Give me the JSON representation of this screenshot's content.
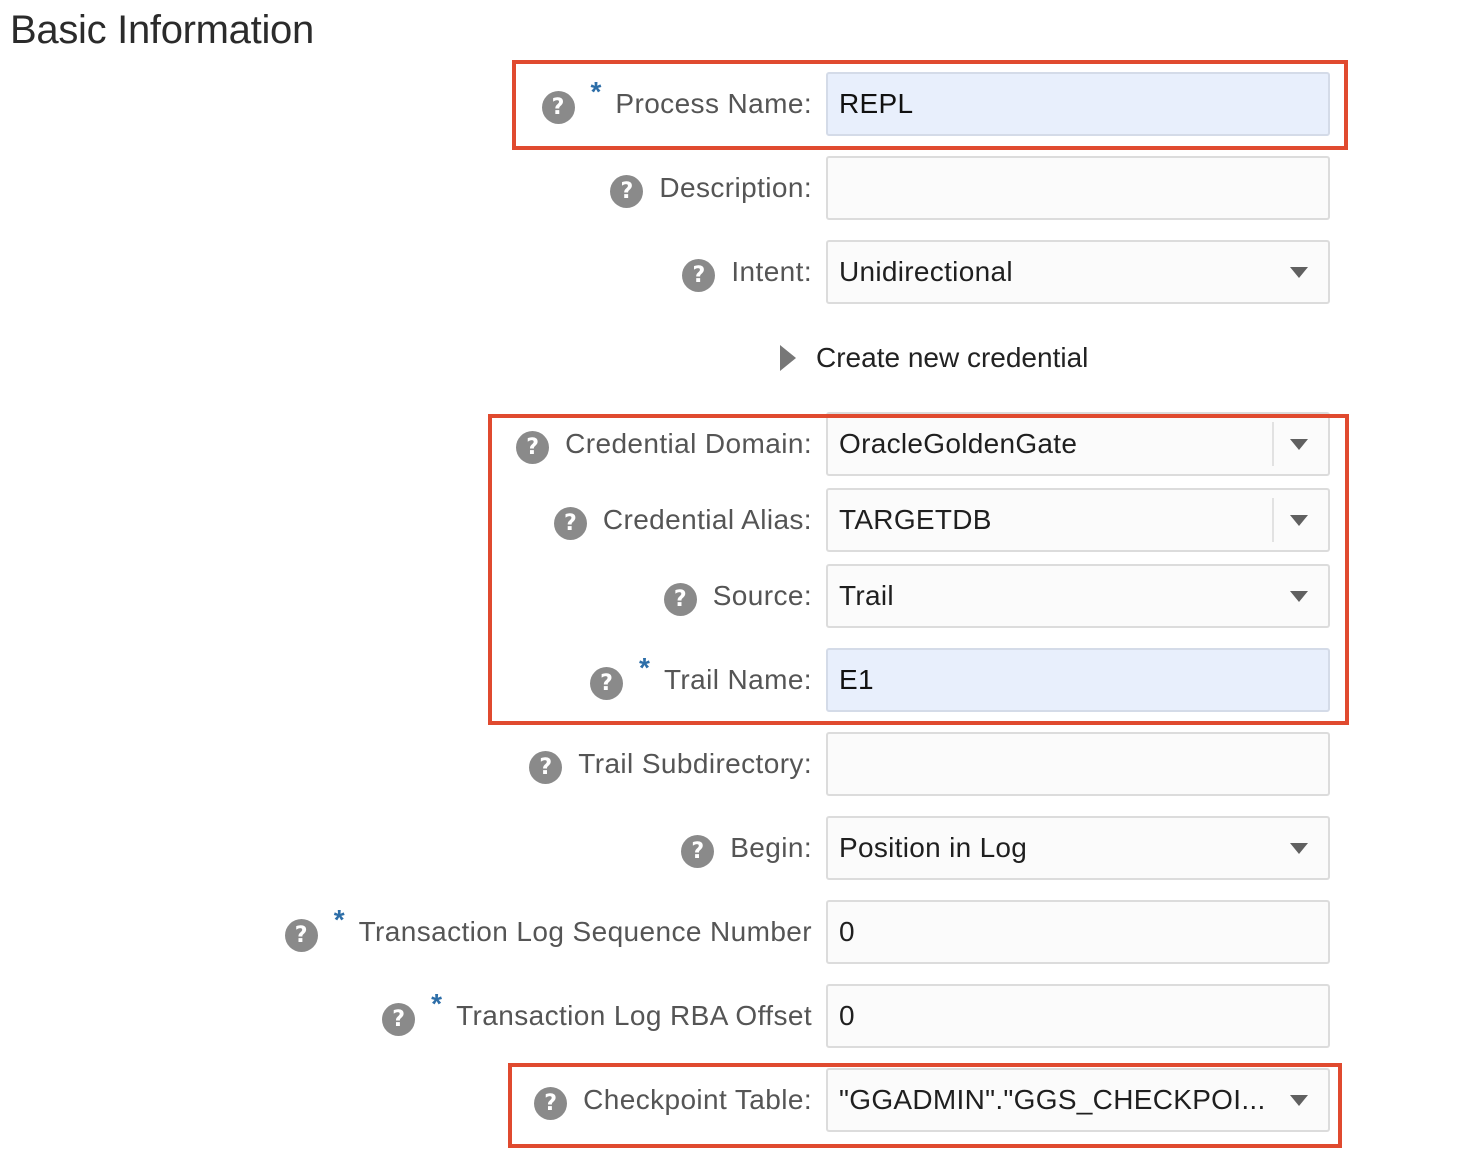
{
  "section_title": "Basic Information",
  "process_name": {
    "label": "Process Name:",
    "value": "REPL",
    "required": true
  },
  "description": {
    "label": "Description:",
    "value": ""
  },
  "intent": {
    "label": "Intent:",
    "value": "Unidirectional"
  },
  "create_credential": {
    "label": "Create new credential"
  },
  "credential_domain": {
    "label": "Credential Domain:",
    "value": "OracleGoldenGate"
  },
  "credential_alias": {
    "label": "Credential Alias:",
    "value": "TARGETDB"
  },
  "source": {
    "label": "Source:",
    "value": "Trail"
  },
  "trail_name": {
    "label": "Trail Name:",
    "value": "E1",
    "required": true
  },
  "trail_subdirectory": {
    "label": "Trail Subdirectory:",
    "value": ""
  },
  "begin": {
    "label": "Begin:",
    "value": "Position in Log"
  },
  "log_sequence": {
    "label": "Transaction Log Sequence Number",
    "value": "0",
    "required": true
  },
  "rba_offset": {
    "label": "Transaction Log RBA Offset",
    "value": "0",
    "required": true
  },
  "checkpoint_table": {
    "label": "Checkpoint Table:",
    "value": "\"GGADMIN\".\"GGS_CHECKPOI..."
  },
  "help_glyph": "?",
  "required_glyph": "*",
  "highlight_color": "#e04a2f"
}
